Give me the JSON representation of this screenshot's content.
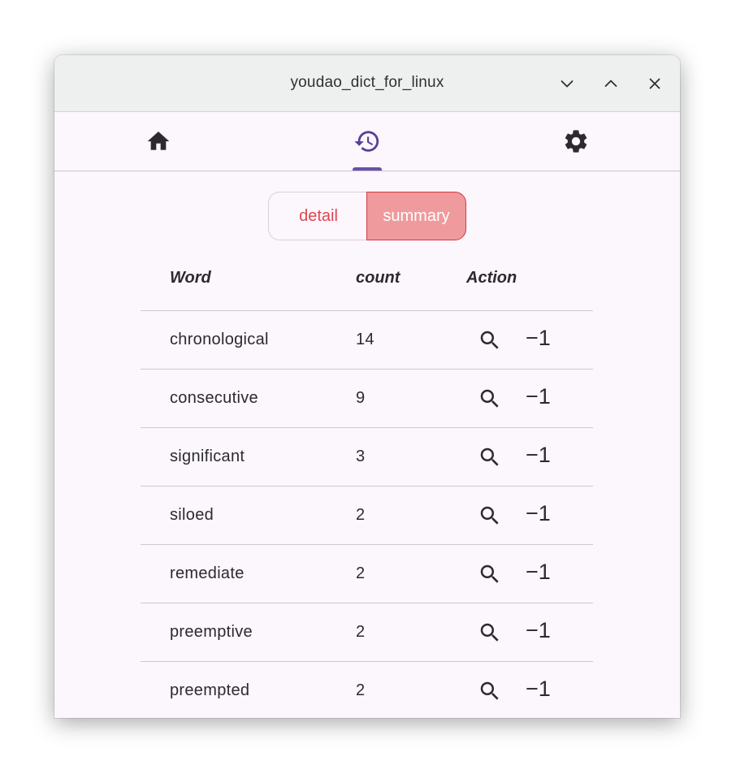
{
  "window": {
    "title": "youdao_dict_for_linux",
    "controls": [
      "minimize",
      "maximize",
      "close"
    ]
  },
  "nav": {
    "tabs": [
      {
        "name": "home",
        "icon": "home-icon",
        "active": false
      },
      {
        "name": "history",
        "icon": "history-icon",
        "active": true
      },
      {
        "name": "settings",
        "icon": "gear-icon",
        "active": false
      }
    ],
    "accent": "#6a4fa8"
  },
  "segmented": {
    "detail_label": "detail",
    "summary_label": "summary",
    "selected": "summary"
  },
  "table": {
    "headers": {
      "word": "Word",
      "count": "count",
      "action": "Action"
    },
    "rows": [
      {
        "word": "chronological",
        "count": "14",
        "minus": "−1"
      },
      {
        "word": "consecutive",
        "count": "9",
        "minus": "−1"
      },
      {
        "word": "significant",
        "count": "3",
        "minus": "−1"
      },
      {
        "word": "siloed",
        "count": "2",
        "minus": "−1"
      },
      {
        "word": "remediate",
        "count": "2",
        "minus": "−1"
      },
      {
        "word": "preemptive",
        "count": "2",
        "minus": "−1"
      },
      {
        "word": "preempted",
        "count": "2",
        "minus": "−1"
      }
    ]
  },
  "colors": {
    "summary_bg": "#ef9a9c",
    "detail_text": "#e0454f",
    "surface": "#fcf6fd"
  }
}
